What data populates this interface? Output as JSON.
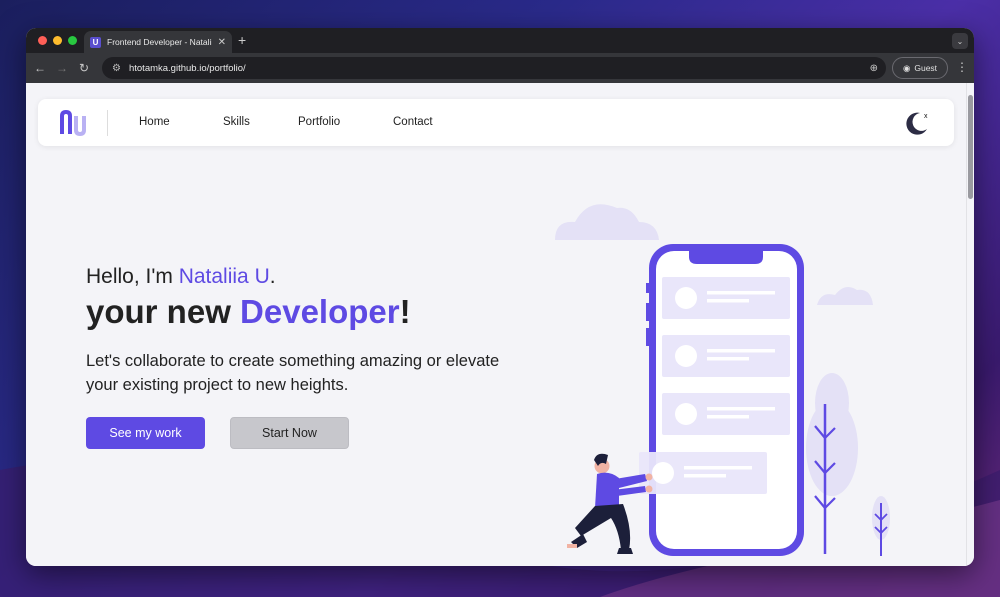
{
  "browser": {
    "tab_title": "Frontend Developer - Nataliia U",
    "tab_favicon": "U",
    "url": "htotamka.github.io/portfolio/",
    "profile_label": "Guest",
    "icons": [
      "back-icon",
      "forward-icon",
      "reload-icon",
      "site-settings-icon",
      "zoom-icon",
      "profile-icon",
      "menu-icon",
      "close-tab-icon",
      "new-tab-icon"
    ]
  },
  "nav": {
    "items": [
      "Home",
      "Skills",
      "Portfolio",
      "Contact"
    ],
    "theme_toggle_mark": "x"
  },
  "hero": {
    "hello_prefix": "Hello, I'm ",
    "name": "Nataliia U",
    "hello_suffix": ".",
    "main_prefix": "your new ",
    "role": "Developer",
    "main_suffix": "!",
    "subtitle": "Let's collaborate to create something amazing or elevate your existing project to new heights.",
    "primary_button": "See my work",
    "secondary_button": "Start Now"
  },
  "colors": {
    "accent": "#5e4ae3",
    "page_bg": "#f4f4f8",
    "secondary_button_bg": "#c7c7cc"
  }
}
